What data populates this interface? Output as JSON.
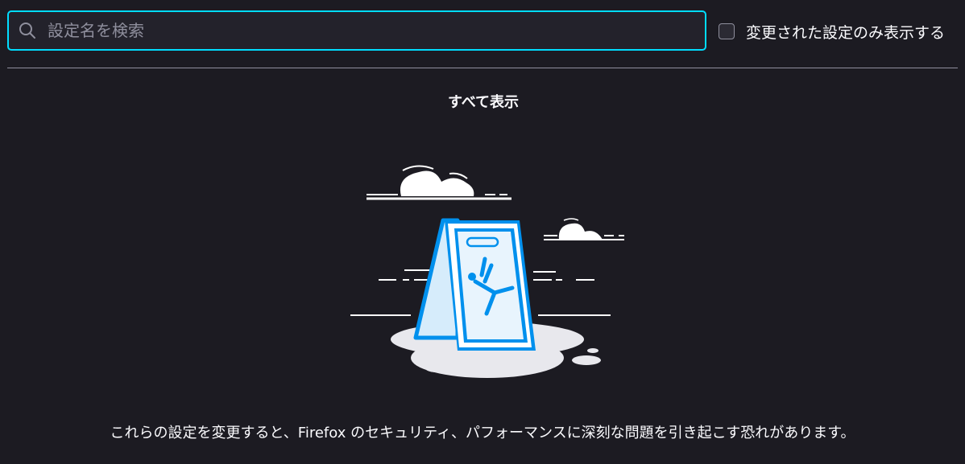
{
  "search": {
    "value": "",
    "placeholder": "設定名を検索",
    "icon": "search-icon"
  },
  "filter": {
    "label": "変更された設定のみ表示する",
    "checked": false
  },
  "show_all_label": "すべて表示",
  "illustration": {
    "icon": "wet-floor-warning-sign-illustration"
  },
  "warning": "これらの設定を変更すると、Firefox のセキュリティ、パフォーマンスに深刻な問題を引き起こす恐れがあります。",
  "colors": {
    "background": "#1c1b22",
    "focus_ring": "#00ddff",
    "accent_blue": "#0090ed",
    "text": "#fbfbfe"
  }
}
